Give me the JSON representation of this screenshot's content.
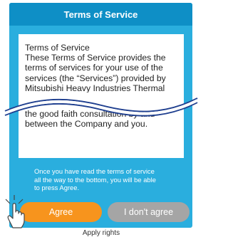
{
  "dialog": {
    "title": "Terms of Service",
    "content_top": "Terms of Service\nThese Terms of Service provides the terms of services for your use of the services (the “Services”) provided by Mitsubishi Heavy Industries Thermal",
    "content_bottom": "the good faith consultation by and between the Company and you.",
    "notice": "Once you have read the terms of service\nall the way to the bottom, you will be able\nto press Agree.",
    "agree_label": "Agree",
    "disagree_label": "I don't agree"
  },
  "footer": {
    "caption": "Apply rights"
  },
  "colors": {
    "dialog_bg": "#2aaede",
    "title_bg": "#0e8fc6",
    "agree_bg": "#f7941d",
    "disagree_bg": "#a5a5a5"
  },
  "icons": {
    "pointer": "hand-pointer-icon",
    "break": "wave-break-icon"
  }
}
